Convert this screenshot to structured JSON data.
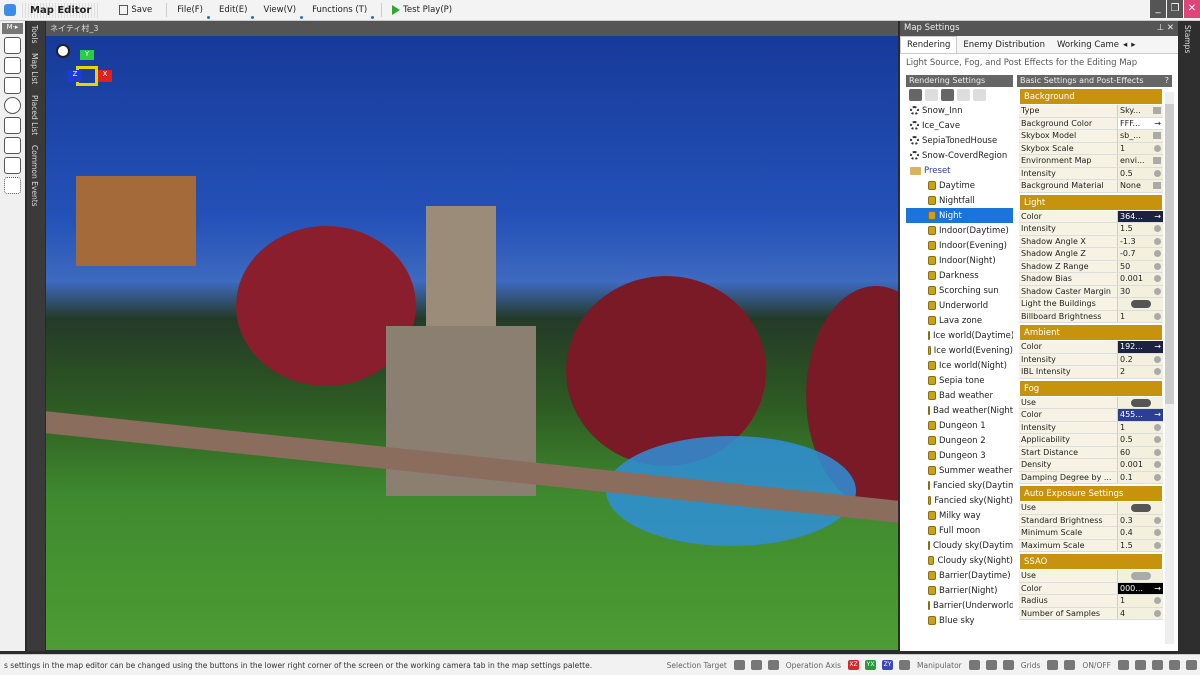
{
  "app": {
    "title": "Map Editor"
  },
  "toolbar": {
    "save": "Save",
    "file": "File(F)",
    "edit": "Edit(E)",
    "view": "View(V)",
    "functions": "Functions (T)",
    "test_play": "Test Play(P)"
  },
  "window_controls": {
    "minimize": "_",
    "restore": "❐",
    "close": "✕"
  },
  "left_strip": {
    "mode": "M·▸"
  },
  "vertical_tabs": [
    "Tools",
    "Map List",
    "Placed List",
    "Common Events"
  ],
  "viewport": {
    "tab_title": "ネイティ村_3",
    "gizmo": {
      "x": "X",
      "y": "Y",
      "z": "Z"
    }
  },
  "map_settings": {
    "title": "Map Settings",
    "pin": "⊥",
    "close": "✕",
    "tabs": [
      "Rendering",
      "Enemy Distribution",
      "Working Came"
    ],
    "description": "Light Source, Fog, and Post Effects for the Editing Map",
    "rendering_settings": {
      "header": "Rendering Settings",
      "items": [
        {
          "label": "Snow_Inn",
          "icon": "gear"
        },
        {
          "label": "Ice_Cave",
          "icon": "gear"
        },
        {
          "label": "SepiaTonedHouse",
          "icon": "gear"
        },
        {
          "label": "Snow-CoverdRegion",
          "icon": "gear"
        },
        {
          "label": "Preset",
          "icon": "folder"
        },
        {
          "label": "Daytime",
          "icon": "lock"
        },
        {
          "label": "Nightfall",
          "icon": "lock"
        },
        {
          "label": "Night",
          "icon": "lock",
          "selected": true
        },
        {
          "label": "Indoor(Daytime)",
          "icon": "lock"
        },
        {
          "label": "Indoor(Evening)",
          "icon": "lock"
        },
        {
          "label": "Indoor(Night)",
          "icon": "lock"
        },
        {
          "label": "Darkness",
          "icon": "lock"
        },
        {
          "label": "Scorching sun",
          "icon": "lock"
        },
        {
          "label": "Underworld",
          "icon": "lock"
        },
        {
          "label": "Lava zone",
          "icon": "lock"
        },
        {
          "label": "Ice world(Daytime)",
          "icon": "lock"
        },
        {
          "label": "Ice world(Evening)",
          "icon": "lock"
        },
        {
          "label": "Ice world(Night)",
          "icon": "lock"
        },
        {
          "label": "Sepia tone",
          "icon": "lock"
        },
        {
          "label": "Bad weather",
          "icon": "lock"
        },
        {
          "label": "Bad weather(Night)",
          "icon": "lock"
        },
        {
          "label": "Dungeon 1",
          "icon": "lock"
        },
        {
          "label": "Dungeon 2",
          "icon": "lock"
        },
        {
          "label": "Dungeon 3",
          "icon": "lock"
        },
        {
          "label": "Summer weather",
          "icon": "lock"
        },
        {
          "label": "Fancied sky(Daytime)",
          "icon": "lock"
        },
        {
          "label": "Fancied sky(Night)",
          "icon": "lock"
        },
        {
          "label": "Milky way",
          "icon": "lock"
        },
        {
          "label": "Full moon",
          "icon": "lock"
        },
        {
          "label": "Cloudy sky(Daytime)",
          "icon": "lock"
        },
        {
          "label": "Cloudy sky(Night)",
          "icon": "lock"
        },
        {
          "label": "Barrier(Daytime)",
          "icon": "lock"
        },
        {
          "label": "Barrier(Night)",
          "icon": "lock"
        },
        {
          "label": "Barrier(Underworld)",
          "icon": "lock"
        },
        {
          "label": "Blue sky",
          "icon": "lock"
        }
      ]
    },
    "properties": {
      "header": "Basic Settings and Post-Effects",
      "help": "?",
      "groups": [
        {
          "name": "Background",
          "rows": [
            {
              "k": "Type",
              "v": "Sky...",
              "ctl": "dd"
            },
            {
              "k": "Background Color",
              "v": "FFF...",
              "ctl": "arrow",
              "style": "white"
            },
            {
              "k": "Skybox Model",
              "v": "sb_...",
              "ctl": "dd"
            },
            {
              "k": "Skybox Scale",
              "v": "1",
              "ctl": "spin"
            },
            {
              "k": "Environment Map",
              "v": "envi...",
              "ctl": "dd"
            },
            {
              "k": "Intensity",
              "v": "0.5",
              "ctl": "spin"
            },
            {
              "k": "Background Material",
              "v": "None",
              "ctl": "dd"
            }
          ]
        },
        {
          "name": "Light",
          "rows": [
            {
              "k": "Color",
              "v": "364...",
              "ctl": "arrow",
              "style": "dark"
            },
            {
              "k": "Intensity",
              "v": "1.5",
              "ctl": "spin"
            },
            {
              "k": "Shadow Angle X",
              "v": "-1.3",
              "ctl": "spin"
            },
            {
              "k": "Shadow Angle Z",
              "v": "-0.7",
              "ctl": "spin"
            },
            {
              "k": "Shadow Z Range",
              "v": "50",
              "ctl": "spin"
            },
            {
              "k": "Shadow Bias",
              "v": "0.001",
              "ctl": "spin"
            },
            {
              "k": "Shadow Caster Margin",
              "v": "30",
              "ctl": "spin"
            },
            {
              "k": "Light the Buildings",
              "v": "",
              "ctl": "toggle-on"
            },
            {
              "k": "Billboard Brightness",
              "v": "1",
              "ctl": "spin"
            }
          ]
        },
        {
          "name": "Ambient",
          "rows": [
            {
              "k": "Color",
              "v": "192...",
              "ctl": "arrow",
              "style": "dark"
            },
            {
              "k": "Intensity",
              "v": "0.2",
              "ctl": "spin"
            },
            {
              "k": "IBL Intensity",
              "v": "2",
              "ctl": "spin"
            }
          ]
        },
        {
          "name": "Fog",
          "rows": [
            {
              "k": "Use",
              "v": "",
              "ctl": "toggle-on"
            },
            {
              "k": "Color",
              "v": "455...",
              "ctl": "arrow",
              "style": "blue"
            },
            {
              "k": "Intensity",
              "v": "1",
              "ctl": "spin"
            },
            {
              "k": "Applicability",
              "v": "0.5",
              "ctl": "spin"
            },
            {
              "k": "Start Distance",
              "v": "60",
              "ctl": "spin"
            },
            {
              "k": "Density",
              "v": "0.001",
              "ctl": "spin"
            },
            {
              "k": "Damping Degree by ...",
              "v": "0.1",
              "ctl": "spin"
            }
          ]
        },
        {
          "name": "Auto Exposure Settings",
          "rows": [
            {
              "k": "Use",
              "v": "",
              "ctl": "toggle-on"
            },
            {
              "k": "Standard Brightness",
              "v": "0.3",
              "ctl": "spin"
            },
            {
              "k": "Minimum Scale",
              "v": "0.4",
              "ctl": "spin"
            },
            {
              "k": "Maximum Scale",
              "v": "1.5",
              "ctl": "spin"
            }
          ]
        },
        {
          "name": "SSAO",
          "rows": [
            {
              "k": "Use",
              "v": "",
              "ctl": "toggle-off"
            },
            {
              "k": "Color",
              "v": "000...",
              "ctl": "arrow",
              "style": "black"
            },
            {
              "k": "Radius",
              "v": "1",
              "ctl": "spin"
            },
            {
              "k": "Number of Samples",
              "v": "4",
              "ctl": "spin"
            }
          ]
        }
      ]
    }
  },
  "stamps_tab": "Stamps",
  "status": {
    "message": "s settings in the map editor can be changed using the buttons in the lower right corner of the screen or the working camera tab in the map settings palette.",
    "selection_target": "Selection Target",
    "operation_axis": "Operation Axis",
    "axes": [
      "XZ",
      "YX",
      "ZY"
    ],
    "manipulator": "Manipulator",
    "grids": "Grids",
    "onoff": "ON/OFF"
  },
  "colors": {
    "accent": "#c8930c",
    "selection": "#1a74d9",
    "play": "#2fa82f"
  }
}
